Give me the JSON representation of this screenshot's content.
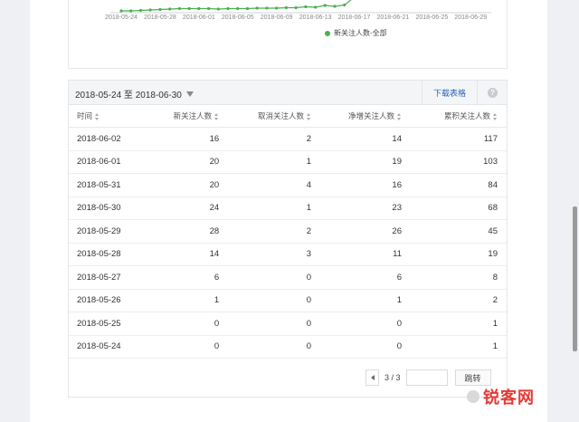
{
  "chart": {
    "x_ticks": [
      "2018-05-24",
      "2018-05-28",
      "2018-06-01",
      "2018-06-05",
      "2018-06-09",
      "2018-06-13",
      "2018-06-17",
      "2018-06-21",
      "2018-06-25",
      "2018-06-29"
    ],
    "legend_label": "新关注人数-全部",
    "series_color": "#4caf50"
  },
  "table": {
    "date_range": "2018-05-24 至 2018-06-30",
    "download_label": "下载表格",
    "help_glyph": "?",
    "columns": [
      "时间",
      "新关注人数",
      "取消关注人数",
      "净增关注人数",
      "累积关注人数"
    ],
    "rows": [
      [
        "2018-06-02",
        "16",
        "2",
        "14",
        "117"
      ],
      [
        "2018-06-01",
        "20",
        "1",
        "19",
        "103"
      ],
      [
        "2018-05-31",
        "20",
        "4",
        "16",
        "84"
      ],
      [
        "2018-05-30",
        "24",
        "1",
        "23",
        "68"
      ],
      [
        "2018-05-29",
        "28",
        "2",
        "26",
        "45"
      ],
      [
        "2018-05-28",
        "14",
        "3",
        "11",
        "19"
      ],
      [
        "2018-05-27",
        "6",
        "0",
        "6",
        "8"
      ],
      [
        "2018-05-26",
        "1",
        "0",
        "1",
        "2"
      ],
      [
        "2018-05-25",
        "0",
        "0",
        "0",
        "1"
      ],
      [
        "2018-05-24",
        "0",
        "0",
        "0",
        "1"
      ]
    ]
  },
  "pager": {
    "page_info": "3 / 3",
    "jump_label": "跳转"
  },
  "watermark": {
    "text": "锐客网"
  }
}
